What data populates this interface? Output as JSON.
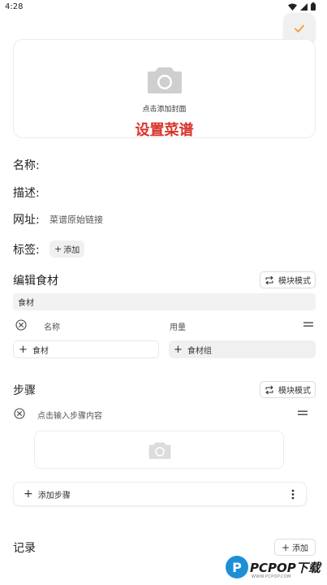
{
  "status": {
    "time": "4:28"
  },
  "cover": {
    "hint": "点击添加封面",
    "title": "设置菜谱"
  },
  "fields": {
    "name_label": "名称:",
    "desc_label": "描述:",
    "url_label": "网址:",
    "url_placeholder": "菜谱原始链接",
    "tags_label": "标签:",
    "tags_add": "添加"
  },
  "ingredients": {
    "title": "编辑食材",
    "mode_label": "模块模式",
    "group_name": "食材",
    "name_placeholder": "名称",
    "amount_placeholder": "用量",
    "add_ingredient": "食材",
    "add_group": "食材组"
  },
  "steps": {
    "title": "步骤",
    "mode_label": "模块模式",
    "step_placeholder": "点击输入步骤内容",
    "add_step": "添加步骤"
  },
  "records": {
    "title": "记录",
    "add_label": "添加"
  },
  "watermark": {
    "logo_letter": "P",
    "brand": "PCPOP下载",
    "sub": "WWW.PCPOP.COM"
  },
  "colors": {
    "accent_orange": "#e8a23a",
    "title_red": "#d9342b",
    "icon_gray": "#c8c8c8"
  }
}
